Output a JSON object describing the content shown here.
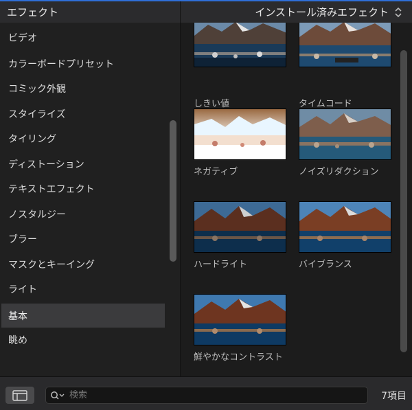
{
  "header": {
    "title": "エフェクト",
    "scope_label": "インストール済みエフェクト",
    "scope_icon": "up-down-chevron-icon"
  },
  "sidebar": {
    "items": [
      {
        "label": "ビデオ",
        "active": false
      },
      {
        "label": "カラーボードプリセット",
        "active": false
      },
      {
        "label": "コミック外観",
        "active": false
      },
      {
        "label": "スタイライズ",
        "active": false
      },
      {
        "label": "タイリング",
        "active": false
      },
      {
        "label": "ディストーション",
        "active": false
      },
      {
        "label": "テキストエフェクト",
        "active": false
      },
      {
        "label": "ノスタルジー",
        "active": false
      },
      {
        "label": "ブラー",
        "active": false
      },
      {
        "label": "マスクとキーイング",
        "active": false
      },
      {
        "label": "ライト",
        "active": false
      },
      {
        "label": "基本",
        "active": true
      },
      {
        "label": "眺め",
        "active": false
      }
    ]
  },
  "effects": [
    {
      "name": "しきい値",
      "style": "threshold"
    },
    {
      "name": "タイムコード",
      "style": "timecode"
    },
    {
      "name": "ネガティブ",
      "style": "negative"
    },
    {
      "name": "ノイズリダクション",
      "style": "noise"
    },
    {
      "name": "ハードライト",
      "style": "hardlight"
    },
    {
      "name": "バイブランス",
      "style": "vibrance"
    },
    {
      "name": "鮮やかなコントラスト",
      "style": "vivid"
    }
  ],
  "footer": {
    "search_placeholder": "検索",
    "item_count": "7項目"
  },
  "colors": {
    "accent": "#2f6fd8",
    "active_row": "#3b3b3d"
  }
}
